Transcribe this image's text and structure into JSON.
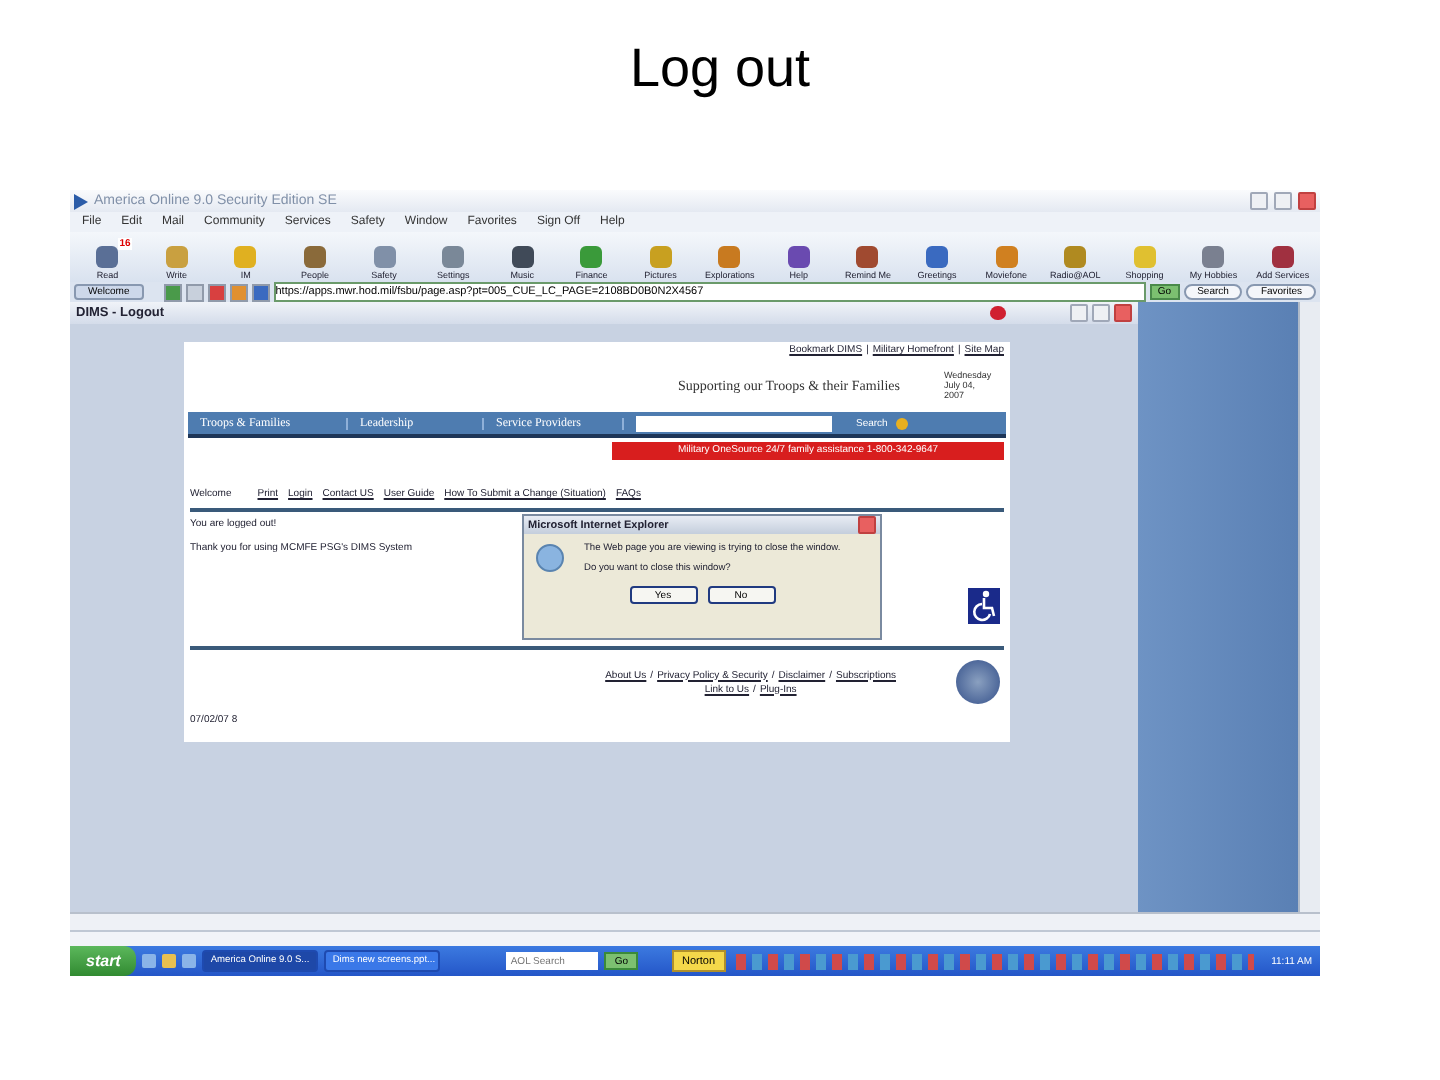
{
  "slide_title": "Log out",
  "window": {
    "title": "America Online 9.0 Security Edition SE"
  },
  "menu": [
    "File",
    "Edit",
    "Mail",
    "Community",
    "Services",
    "Safety",
    "Window",
    "Favorites",
    "Sign Off",
    "Help"
  ],
  "toolbar": [
    {
      "label": "Read",
      "color": "#5a6f96",
      "badge": "16"
    },
    {
      "label": "Write",
      "color": "#c9a040"
    },
    {
      "label": "IM",
      "color": "#e0b020"
    },
    {
      "label": "People",
      "color": "#8a6a3a"
    },
    {
      "label": "Safety",
      "color": "#8090a8"
    },
    {
      "label": "Settings",
      "color": "#7a8898"
    },
    {
      "label": "Music",
      "color": "#404a58"
    },
    {
      "label": "Finance",
      "color": "#3a9a3a"
    },
    {
      "label": "Pictures",
      "color": "#c8a020"
    },
    {
      "label": "Explorations",
      "color": "#c87a20"
    },
    {
      "label": "Help",
      "color": "#6a4ab0"
    },
    {
      "label": "Remind Me",
      "color": "#a04a30"
    },
    {
      "label": "Greetings",
      "color": "#3a6ac0"
    },
    {
      "label": "Moviefone",
      "color": "#d08020"
    },
    {
      "label": "Radio@AOL",
      "color": "#b08a20"
    },
    {
      "label": "Shopping",
      "color": "#e0c030"
    },
    {
      "label": "My Hobbies",
      "color": "#7a8090"
    },
    {
      "label": "Add Services",
      "color": "#a03040"
    }
  ],
  "address_bar": {
    "button": "Welcome",
    "url": "https://apps.mwr.hod.mil/fsbu/page.asp?pt=005_CUE_LC_PAGE=2108BD0B0N2X4567",
    "go": "Go",
    "search": "Search",
    "favorites": "Favorites"
  },
  "inner_window": {
    "title": "DIMS - Logout"
  },
  "page": {
    "top_links": [
      "Bookmark DIMS",
      "Military Homefront",
      "Site Map"
    ],
    "top_links_separator": "|",
    "footer_separator": "/",
    "tagline": "Supporting our Troops & their Families",
    "date": [
      "Wednesday",
      "July 04,",
      "2007"
    ],
    "nav": [
      "Troops & Families",
      "Leadership",
      "Service Providers"
    ],
    "search_button": "Search",
    "banner": "Military OneSource 24/7 family assistance 1-800-342-9647",
    "welcome": "Welcome",
    "links": [
      "Print",
      "Login",
      "Contact US",
      "User Guide",
      "How To Submit a Change (Situation)",
      "FAQs"
    ],
    "message": "You are logged out!",
    "thanks": "Thank you for using MCMFE PSG's DIMS System",
    "footer_links": [
      "About Us",
      "Privacy Policy & Security",
      "Disclaimer",
      "Subscriptions"
    ],
    "footer_links2": [
      "Link to Us",
      "Plug-Ins"
    ],
    "page_date": "07/02/07 8"
  },
  "dialog": {
    "title": "Microsoft Internet Explorer",
    "message": "The Web page you are viewing is trying to close the window.",
    "question": "Do you want to close this window?",
    "buttons": [
      "Yes",
      "No"
    ]
  },
  "taskbar": {
    "start": "start",
    "tasks": [
      {
        "label": "America Online 9.0 S...",
        "selected": true
      },
      {
        "label": "Dims new screens.ppt...",
        "selected": false
      }
    ],
    "search_placeholder": "AOL Search",
    "go": "Go",
    "norton": "Norton",
    "clock": "11:11 AM"
  }
}
